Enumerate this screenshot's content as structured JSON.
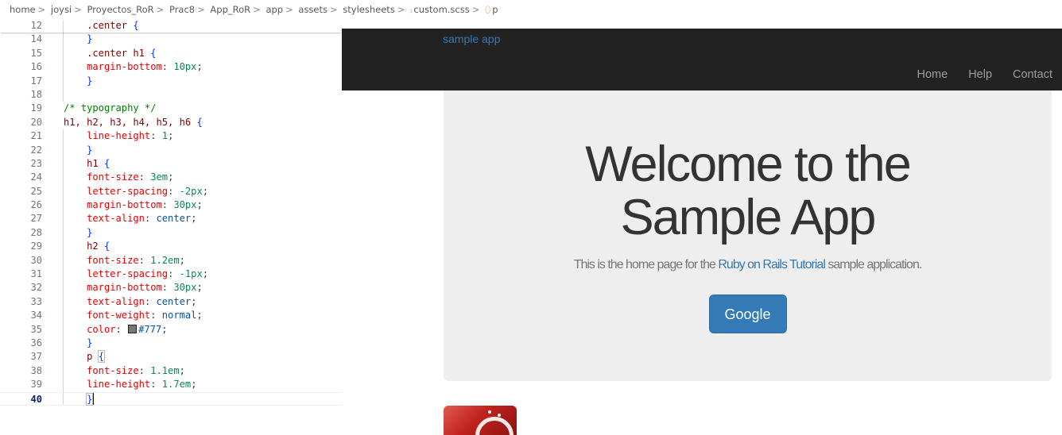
{
  "breadcrumb": {
    "items": [
      "home",
      "joysi",
      "Proyectos_RoR",
      "Prac8",
      "App_RoR",
      "app",
      "assets",
      "stylesheets"
    ],
    "file": "custom.scss",
    "symbol": "p",
    "separator": ">"
  },
  "editor": {
    "lines": {
      "l12": {
        "num": "12",
        "sel": ".center",
        "br": "{"
      },
      "l14": {
        "num": "14",
        "br": "}"
      },
      "l15": {
        "num": "15",
        "sel": ".center h1",
        "br": "{"
      },
      "l16": {
        "num": "16",
        "prop": "margin-bottom",
        "val": "10px"
      },
      "l17": {
        "num": "17",
        "br": "}"
      },
      "l18": {
        "num": "18"
      },
      "l19": {
        "num": "19",
        "comment": "/* typography */"
      },
      "l20": {
        "num": "20",
        "sel": "h1, h2, h3, h4, h5, h6",
        "br": "{"
      },
      "l21": {
        "num": "21",
        "prop": "line-height",
        "val": "1"
      },
      "l22": {
        "num": "22",
        "br": "}"
      },
      "l23": {
        "num": "23",
        "sel": "h1",
        "br": "{"
      },
      "l24": {
        "num": "24",
        "prop": "font-size",
        "val": "3em"
      },
      "l25": {
        "num": "25",
        "prop": "letter-spacing",
        "val": "-2px"
      },
      "l26": {
        "num": "26",
        "prop": "margin-bottom",
        "val": "30px"
      },
      "l27": {
        "num": "27",
        "prop": "text-align",
        "val": "center"
      },
      "l28": {
        "num": "28",
        "br": "}"
      },
      "l29": {
        "num": "29",
        "sel": "h2",
        "br": "{"
      },
      "l30": {
        "num": "30",
        "prop": "font-size",
        "val": "1.2em"
      },
      "l31": {
        "num": "31",
        "prop": "letter-spacing",
        "val": "-1px"
      },
      "l32": {
        "num": "32",
        "prop": "margin-bottom",
        "val": "30px"
      },
      "l33": {
        "num": "33",
        "prop": "text-align",
        "val": "center"
      },
      "l34": {
        "num": "34",
        "prop": "font-weight",
        "val": "normal"
      },
      "l35": {
        "num": "35",
        "prop": "color",
        "val": "#777"
      },
      "l36": {
        "num": "36",
        "br": "}"
      },
      "l37": {
        "num": "37",
        "sel": "p",
        "br": "{"
      },
      "l38": {
        "num": "38",
        "prop": "font-size",
        "val": "1.1em"
      },
      "l39": {
        "num": "39",
        "prop": "line-height",
        "val": "1.7em"
      },
      "l40": {
        "num": "40",
        "br": "}"
      }
    },
    "swatch_color": "#777777"
  },
  "site": {
    "logo": "sample app",
    "nav": [
      "Home",
      "Help",
      "Contact"
    ],
    "hero": {
      "title_line1": "Welcome to the",
      "title_line2": "Sample App",
      "subtitle_before": "This is the home page for the ",
      "subtitle_link": "Ruby on Rails Tutorial",
      "subtitle_after": " sample application.",
      "button": "Google"
    },
    "colors": {
      "navbar": "#222222",
      "link": "#337ab7",
      "button": "#337ab7",
      "jumbotron": "#eeeeee"
    }
  }
}
